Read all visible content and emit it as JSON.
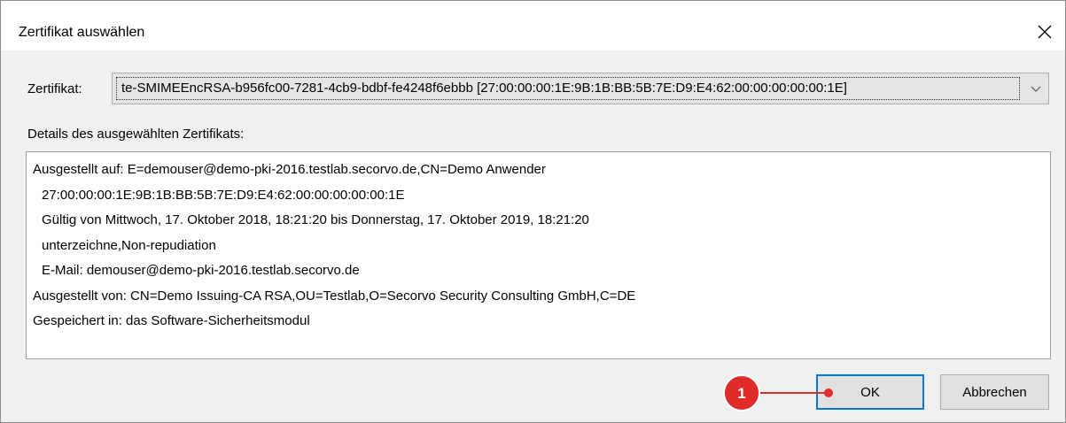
{
  "window": {
    "title": "Zertifikat auswählen"
  },
  "certificate": {
    "label": "Zertifikat:",
    "selected": "te-SMIMEEncRSA-b956fc00-7281-4cb9-bdbf-fe4248f6ebbb [27:00:00:00:1E:9B:1B:BB:5B:7E:D9:E4:62:00:00:00:00:00:1E]"
  },
  "details": {
    "label": "Details des ausgewählten Zertifikats:",
    "lines": [
      "Ausgestellt auf: E=demouser@demo-pki-2016.testlab.secorvo.de,CN=Demo Anwender",
      "27:00:00:00:1E:9B:1B:BB:5B:7E:D9:E4:62:00:00:00:00:00:1E",
      "Gültig von Mittwoch, 17. Oktober 2018, 18:21:20 bis Donnerstag, 17. Oktober 2019, 18:21:20",
      "unterzeichne,Non-repudiation",
      "E-Mail: demouser@demo-pki-2016.testlab.secorvo.de",
      "Ausgestellt von: CN=Demo Issuing-CA RSA,OU=Testlab,O=Secorvo Security Consulting GmbH,C=DE",
      "Gespeichert in: das Software-Sicherheitsmodul"
    ]
  },
  "buttons": {
    "ok": "OK",
    "cancel": "Abbrechen"
  },
  "annotation": {
    "number": "1",
    "color": "#e02b2b"
  }
}
